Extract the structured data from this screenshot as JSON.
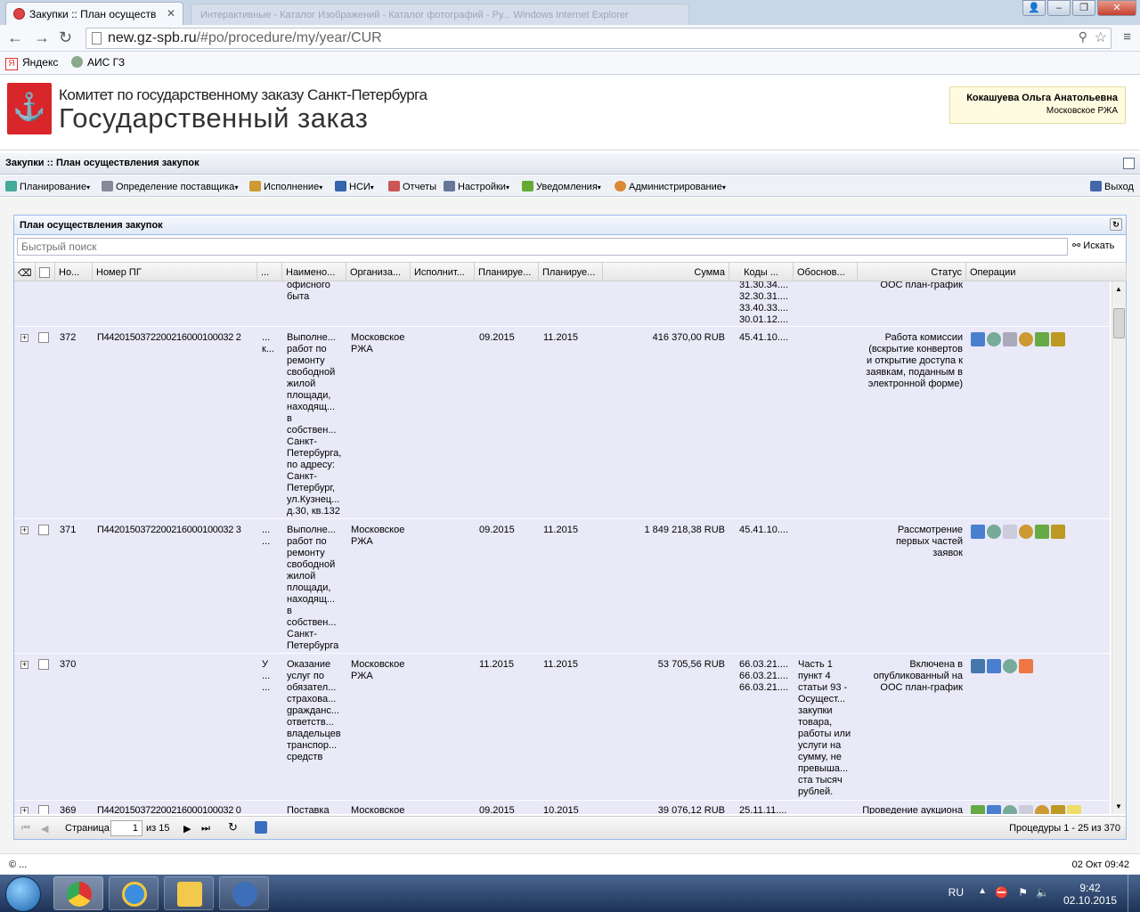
{
  "browser": {
    "tab_active": "Закупки :: План осуществ",
    "tab_background": "Интерактивные - Каталог Изображений - Каталог фотографий - Ру... Windows Internet Explorer",
    "url_host": "new.gz-spb.ru",
    "url_path": "/#po/procedure/my/year/CUR",
    "bookmarks": [
      "Яндекс",
      "АИС ГЗ"
    ],
    "bookmark_yandex_glyph": "Я"
  },
  "header": {
    "org_name": "Комитет по государственному заказу Санкт-Петербурга",
    "brand": "Государственный заказ",
    "user_name": "Кокашуева Ольга Анатольевна",
    "user_org": "Московское РЖА"
  },
  "app": {
    "title": "Закупки :: План осуществления закупок",
    "menu": [
      "Планирование",
      "Определение поставщика",
      "Исполнение",
      "НСИ",
      "Отчеты",
      "Настройки",
      "Уведомления",
      "Администрирование"
    ],
    "exit_label": "Выход"
  },
  "panel": {
    "title": "План осуществления закупок",
    "search_placeholder": "Быстрый поиск",
    "search_button": "Искать"
  },
  "grid": {
    "columns": [
      "Но...",
      "Номер ПГ",
      "...",
      "Наимено...",
      "Организа...",
      "Исполнит...",
      "Планируе...",
      "Планируе...",
      "Сумма",
      "Коды ...",
      "Обоснов...",
      "Статус",
      "Операции"
    ],
    "partial_row": {
      "name": "офисного\nбыта",
      "codes": "31.30.34....\n32.30.31....\n33.40.33....\n30.01.12....",
      "status": "ООС план-график"
    },
    "rows": [
      {
        "num": "372",
        "pg": "П442015037220021600010003 22",
        "pg_text": "П4420150372200216000100032 2",
        "x": "...\nк...",
        "name": "Выполне...\nработ по\nремонту\nсвободной\nжилой\nплощади,\nнаходящ...\nв\nсобствен...\nСанкт-\nПетербурга,\nпо адресу:\nСанкт-\nПетербург,\nул.Кузнец...\nд.30, кв.132",
        "org": "Московское\nРЖА",
        "executor": "",
        "plan1": "09.2015",
        "plan2": "11.2015",
        "sum": "416 370,00 RUB",
        "codes": "45.41.10....",
        "basis": "",
        "status": "Работа комиссии\n(вскрытие конвертов\nи открытие доступа к\nзаявкам, поданным в\nэлектронной форме)"
      },
      {
        "num": "371",
        "pg_text": "П4420150372200216000100032 3",
        "x": "...\n...",
        "name": "Выполне...\nработ по\nремонту\nсвободной\nжилой\nплощади,\nнаходящ...\nв\nсобствен...\nСанкт-\nПетербурга",
        "org": "Московское\nРЖА",
        "executor": "",
        "plan1": "09.2015",
        "plan2": "11.2015",
        "sum": "1 849 218,38 RUB",
        "codes": "45.41.10....",
        "basis": "",
        "status": "Рассмотрение\nпервых частей\nзаявок"
      },
      {
        "num": "370",
        "pg_text": "",
        "x": "У\n...\n...",
        "name": "Оказание\nуслуг по\nобязател...\nстрахова...\ngражданс...\nответств...\nвладельцев\nтранспор...\nсредств",
        "org": "Московское\nРЖА",
        "executor": "",
        "plan1": "11.2015",
        "plan2": "11.2015",
        "sum": "53 705,56 RUB",
        "codes": "66.03.21....\n66.03.21....\n66.03.21....",
        "basis": "Часть 1\nпункт 4\nстатьи 93 -\nОсущест...\nзакупки\nтовара,\nработы или\nуслуги на\nсумму, не\nпревыша...\nста тысяч\nрублей.",
        "status": "Включена в\nопубликованный на\nООС план-график"
      },
      {
        "num": "369",
        "pg_text": "П4420150372200216000100032 0",
        "x": "",
        "name": "Поставка",
        "org": "Московское",
        "executor": "",
        "plan1": "09.2015",
        "plan2": "10.2015",
        "sum": "39 076,12 RUB",
        "codes": "25.11.11....",
        "basis": "",
        "status": "Проведение аукциона"
      }
    ]
  },
  "pager": {
    "page_label": "Страница",
    "page_value": "1",
    "of_label": "из 15",
    "summary": "Процедуры 1 - 25 из 370"
  },
  "footer": {
    "copyright": "© ...",
    "datetime": "02 Окт 09:42"
  },
  "taskbar": {
    "lang": "RU",
    "time": "9:42",
    "date": "02.10.2015"
  },
  "colors": {
    "accent": "#99bbe8",
    "row_bg": "#e9e9f8",
    "logo_red": "#d8262b"
  }
}
